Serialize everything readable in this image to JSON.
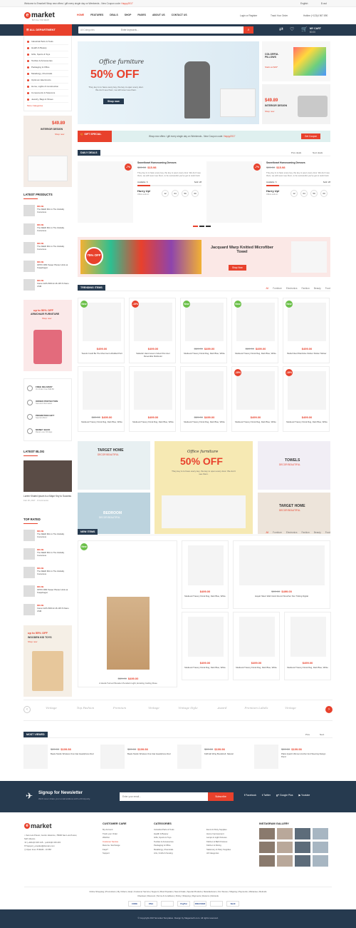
{
  "topbar": {
    "welcome": "Welcome to Emarket! Wrap new offers / gift every single day on Weekends - New Coupon code:",
    "coupon": "Happy2017",
    "lang": "English",
    "currency": "$ usd"
  },
  "header": {
    "logo": "market",
    "logo_e": "e",
    "tagline": "BUY ALL YOU WANT",
    "nav": [
      "HOME",
      "FEATURES",
      "DEALS",
      "SHOP",
      "PAGES",
      "ABOUT US",
      "CONTACT US"
    ],
    "login": "Login or Register",
    "track": "Track Your Order",
    "hotline": "Hotline (+123)4 567 890"
  },
  "searchbar": {
    "dept": "ALL DEPARTMENT",
    "category": "All Categories",
    "placeholder": "Enter keywords...",
    "cart": "MY CART",
    "cart_total": "$0.00"
  },
  "sidebar": {
    "categories": [
      "Industrial Parts & Tools",
      "Health & Beauty",
      "Gifts, Sports & Toys",
      "Textiles & Accessories",
      "Packaging & Office",
      "Metallurgy, Chemicals",
      "Optimum Electronics",
      "Home, Lights & Construction",
      "Components & Telecoms",
      "Jewelry, Bags & Shoes"
    ],
    "more": "More Categories"
  },
  "side_banner1": {
    "price": "$49.89",
    "title": "INTERIOR DESIGN",
    "link": "Shop now"
  },
  "latest_products": {
    "title": "LATEST PRODUCTS",
    "items": [
      {
        "price": "$60.89",
        "name": "The FEED Mini is The Globally Conscious"
      },
      {
        "price": "$60.89",
        "name": "The FEED Mini is The Globally Conscious"
      },
      {
        "price": "$60.89",
        "name": "The FEED Mini is The Globally Conscious"
      },
      {
        "price": "$60.89",
        "name": "OPPO R9S Tasaer Pluster Hints at Snapdragon"
      },
      {
        "price": "$60.89",
        "name": "Canon EOS 80D kit 18-135 IS Nano USM"
      }
    ]
  },
  "side_banner2": {
    "offer": "up to 50% OFF",
    "title": "ARMCHAIR FURNITURE",
    "link": "Shop now"
  },
  "services": [
    {
      "title": "FREE DELIVERY",
      "sub": "On Order Over $49.86"
    },
    {
      "title": "ORDER PROTECTION",
      "sub": "Secured information"
    },
    {
      "title": "PROMOTION GIFT",
      "sub": "Special offers!"
    },
    {
      "title": "MONEY BACK",
      "sub": "Return over 30 days"
    }
  ],
  "latest_blog": {
    "title": "LATEST BLOG",
    "post": "Lorem Khaled Ipsum is a Major Key to Success",
    "date": "Feb 18, 2017",
    "comments": "0 Comments"
  },
  "top_rated": {
    "title": "TOP RATED",
    "items": [
      {
        "price": "$60.89",
        "name": "The FEED Mini is The Globally Conscious"
      },
      {
        "price": "$60.89",
        "name": "The FEED Mini is The Globally Conscious"
      },
      {
        "price": "$60.89",
        "name": "The FEED Mini is The Globally Conscious"
      },
      {
        "price": "$60.89",
        "name": "OPPO R9S Tasaer Pluster Hints at Snapdragon"
      },
      {
        "price": "$60.89",
        "name": "Canon EOS 80D kit 18-135 IS Nano USM"
      }
    ]
  },
  "side_banner3": {
    "offer": "up to 55% OFF",
    "title": "WOODEN KID TOYS",
    "link": "Shop now"
  },
  "hero": {
    "title": "Office furniture",
    "discount": "50% OFF",
    "desc": "They key is to have every key, the key to open every door. We don't see them, we will never see them.",
    "btn": "Shop now"
  },
  "side_hero1": {
    "title": "COLORFUL PILLOWS",
    "sub": "Starts at $29*"
  },
  "side_hero2": {
    "price": "$49.89",
    "title": "INTERIOR DESIGN",
    "link": "Shop now"
  },
  "gift_bar": {
    "label": "GIFT SPECIAL",
    "text": "Wrap new offers / gift every single day on Weekends - New Coupon code:",
    "code": "Happy2017",
    "btn": "Get Coupon"
  },
  "daily_deals": {
    "title": "DAILY DEALS",
    "prev": "Prev deals",
    "next": "Next deals",
    "items": [
      {
        "badge": "-7%",
        "name": "Sweetheart Homecoming Dresses",
        "old": "$85.50",
        "price": "$15.98",
        "desc": "They key is to have every key, the key to open every door. We don't see them, we will never see them, to be successful you've got to work hard.",
        "available": "Available: 6",
        "sold": "Sold: 28",
        "hurry": "Hurry Up!",
        "ends": "Offers ends in:",
        "count": [
          "12",
          "04",
          "59",
          "00"
        ]
      },
      {
        "badge": "-7%",
        "name": "Sweetheart Homecoming Dresses",
        "old": "$85.50",
        "price": "$15.98",
        "desc": "They key is to have every key, the key to open every door. We don't see them, we will never see them, to be successful you've got to work hard.",
        "available": "Available: 6",
        "sold": "Sold: 28",
        "hurry": "Hurry Up!",
        "ends": "Offers ends in:",
        "count": [
          "12",
          "04",
          "59",
          "00"
        ]
      }
    ]
  },
  "towel_banner": {
    "badge": "75% OFF",
    "title": "Jacquard Warp Knitted Microfiber Towel",
    "btn": "Shop Now"
  },
  "trending": {
    "title": "TRENDING ITEMS",
    "tabs": [
      "All",
      "Furniture",
      "Electronics",
      "Fashion",
      "Beauty",
      "Food"
    ],
    "row1": [
      {
        "badge": "New",
        "old": "",
        "price": "$499.00",
        "name": "Towels Could Be The Most Germ-Riddled Part"
      },
      {
        "badge": "-15%",
        "old": "",
        "price": "$499.00",
        "name": "Safavieh Hand woven Indoor/Out door Reversible Multicolor"
      },
      {
        "badge": "New",
        "old": "$89.00",
        "price": "$499.00",
        "name": "Medieval Tracery Floral Rug, Dark Blue, White"
      },
      {
        "badge": "New",
        "old": "$89.00",
        "price": "$499.00",
        "name": "Medieval Tracery Floral Rug, Dark Blue, White"
      },
      {
        "badge": "New",
        "old": "",
        "price": "$499.00",
        "name": "Bella Fitted Wardrobe Sticker Sticker Sticker"
      }
    ],
    "row2": [
      {
        "badge": "",
        "old": "$89.00",
        "price": "$499.00",
        "name": "Medieval Tracery Floral Rug, Dark Blue, White"
      },
      {
        "badge": "",
        "old": "",
        "price": "$499.00",
        "name": "Medieval Tracery Floral Rug, Dark Blue, White"
      },
      {
        "badge": "",
        "old": "$89.00",
        "price": "$499.00",
        "name": "Medieval Tracery Floral Rug, Dark Blue, White"
      },
      {
        "badge": "-15%",
        "old": "",
        "price": "$499.00",
        "name": "Medieval Tracery Floral Rug, Dark Blue, White"
      },
      {
        "badge": "-15%",
        "old": "",
        "price": "$499.00",
        "name": "Medieval Tracery Floral Rug, Dark Blue, White"
      }
    ]
  },
  "promo": {
    "target1": "TARGET HOME",
    "decor1": "DECOR BEAUTIFUL",
    "bedroom": "BEDROOM",
    "decor2": "DECOR BEAUTIFUL",
    "office": "Office furniture",
    "off": "50% OFF",
    "desc": "They key is to have every key, the key to open every door. We don't see them.",
    "towels": "TOWELS",
    "decor3": "DECOR BEAUTIFUL",
    "target2": "TARGET HOME",
    "decor4": "DECOR BEAUTIFUL"
  },
  "new_items": {
    "title": "NEW ITEMS",
    "tabs": [
      "All",
      "Furniture",
      "Electronics",
      "Fashion",
      "Beauty",
      "Food"
    ],
    "big": {
      "badge": "New",
      "old": "$89.00",
      "price": "$499.00",
      "name": "A Hand-Turned Wooden Pendant Light, Existing Ceiling Rose"
    },
    "items": [
      {
        "old": "",
        "price": "$499.00",
        "name": "Medieval Tracery Floral Rug, Dark Blue, White"
      },
      {
        "old": "$89.00",
        "price": "$499.00",
        "name": "Hayah Silent Wall Clock Round Stretcher Non Ticking Digital"
      },
      {
        "old": "",
        "price": "$499.00",
        "name": "Medieval Tracery Floral Rug, Dark Blue, White"
      },
      {
        "old": "",
        "price": "$499.00",
        "name": "Medieval Tracery Floral Rug, Dark Blue, White"
      },
      {
        "old": "",
        "price": "$499.00",
        "name": "Medieval Tracery Floral Rug, Dark Blue, White"
      }
    ]
  },
  "brands": [
    "Vintage",
    "Top Fashion",
    "Premium",
    "Vintage",
    "Vintage Style",
    "Award",
    "Premium Labels",
    "Vintage"
  ],
  "most_viewed": {
    "title": "MOST VIEWED",
    "prev": "Prev",
    "next": "Next",
    "items": [
      {
        "old": "$89.00",
        "price": "$199.98",
        "name": "Beats Studio Wireless Over Ear Headphone Red"
      },
      {
        "old": "$89.00",
        "price": "$199.98",
        "name": "Beats Studio Wireless Over Ear Headphone Red"
      },
      {
        "old": "$89.00",
        "price": "$199.98",
        "name": "KidKraft Wing Bookshelf, Natural"
      },
      {
        "old": "$89.00",
        "price": "$199.98",
        "name": "Plaza Quartz Women Anchor And Steering Design Pend"
      }
    ]
  },
  "newsletter": {
    "title": "Signup for Newsletter",
    "sub": "We'll never share your email address with a third-party.",
    "placeholder": "Enter your email...",
    "btn": "Subscribe",
    "social": [
      "Facebook",
      "Twitter",
      "Google Plus",
      "Youtube"
    ]
  },
  "footer": {
    "address": "San Luis Potosí, Centro Historico, 78000 San Luis Potosí, SLP, Mexico",
    "phone": "(+0214)0 315 215 - (+0214)0 315 215",
    "email": "Support_emarket@domain.com",
    "open": "Open time: 8:00AM - 10:PM",
    "customer_title": "CUSTOMER CARE",
    "customer": [
      "My Account",
      "Track your Order",
      "Wishlist",
      "Customer Service",
      "Returns / Exchange",
      "Faqs?",
      "Support"
    ],
    "cat_title": "CATEGORIES",
    "cats1": [
      "Industrial Parts & Tools",
      "Health & Beauty",
      "Gifts, Sports & Toys",
      "Textiles & Accessories",
      "Packaging & Office",
      "Metallurgy, Chemicals",
      "Arts, Crafts & Sewing"
    ],
    "cats2": [
      "Event & Party Supplies",
      "Home Improvement",
      "Lamps & Light Fixtures",
      "Kitchen & Bath Fixtures",
      "Kitchen & Dining",
      "Stationery & Party Supplies",
      "All Categories"
    ],
    "gallery_title": "INSTAGRAM GALLERY",
    "links1": "Online Shopping | Promotions | My Orders | Help | Customer Service | Support | Most Populars | New Arrivals | Special Products | Manufacturers | Our Stores | Shipping | Payments | Warantee | Refunds",
    "links2": "Checkout | Discount | Terms & Conditions | Policy | Shipping | Payments | Returns | Refunds",
    "payments": [
      "CODE",
      "VISA",
      "",
      "PayPal",
      "DISCOVER",
      "",
      "Skrill"
    ],
    "copyright": "© Copyright 2017 Emarket Templates. Design by Magentech.com. All rights reserved."
  },
  "colors": {
    "accent": "#e8412c",
    "dark": "#263a4f"
  }
}
